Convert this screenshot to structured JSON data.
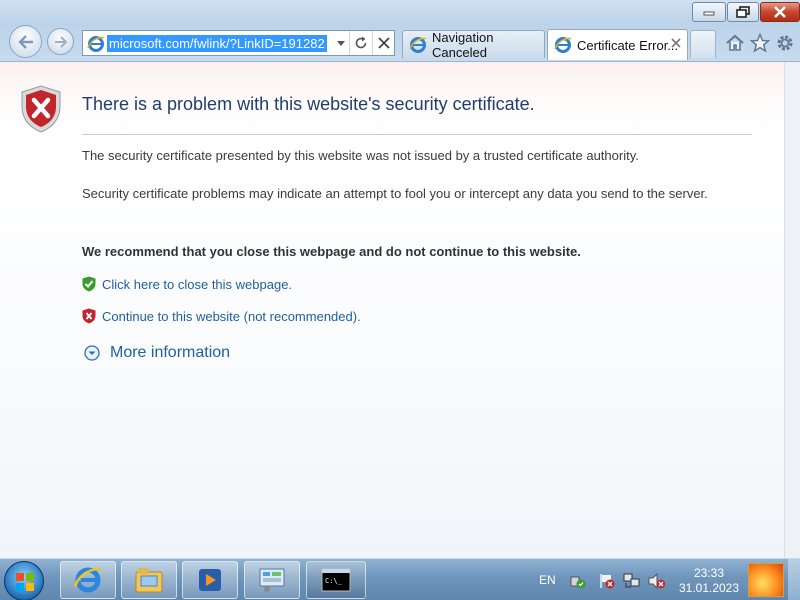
{
  "browser": {
    "address": {
      "url": "microsoft.com/fwlink/?LinkID=191282"
    },
    "tabs": [
      {
        "label": "Navigation Canceled",
        "active": false
      },
      {
        "label": "Certificate Error...",
        "active": true
      }
    ]
  },
  "page": {
    "title": "There is a problem with this website's security certificate.",
    "paragraph1": "The security certificate presented by this website was not issued by a trusted certificate authority.",
    "paragraph2": "Security certificate problems may indicate an attempt to fool you or intercept any data you send to the server.",
    "recommendation": "We recommend that you close this webpage and do not continue to this website.",
    "close_link": "Click here to close this webpage.",
    "continue_link": "Continue to this website (not recommended).",
    "more_info": "More information"
  },
  "taskbar": {
    "language": "EN",
    "time": "23:33",
    "date": "31.01.2023"
  },
  "colors": {
    "link": "#1f5f9e",
    "title": "#1f3e6e",
    "selection": "#3399ff",
    "danger": "#c0262b",
    "safe": "#3a9b2e"
  }
}
